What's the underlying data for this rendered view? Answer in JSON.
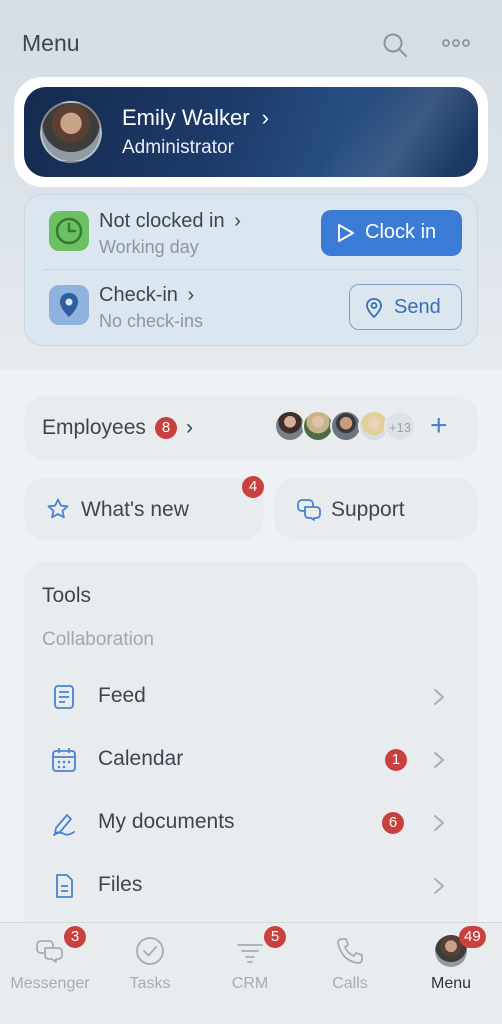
{
  "header": {
    "title": "Menu",
    "search_icon": "search-icon",
    "more_icon": "more-horizontal-icon"
  },
  "profile": {
    "name": "Emily Walker",
    "role": "Administrator",
    "chevron": "›"
  },
  "clock": {
    "status_title": "Not clocked in",
    "status_sub": "Working day",
    "clock_button": "Clock in",
    "checkin_title": "Check-in",
    "checkin_sub": "No check-ins",
    "send_button": "Send",
    "chevron": "›"
  },
  "employees": {
    "label": "Employees",
    "badge": "8",
    "more_count": "+13",
    "add": "+",
    "chevron": "›"
  },
  "whats_new": {
    "label": "What's new",
    "badge": "4"
  },
  "support": {
    "label": "Support"
  },
  "tools": {
    "title": "Tools",
    "section": "Collaboration",
    "items": [
      {
        "label": "Feed",
        "icon": "feed-icon",
        "badge": ""
      },
      {
        "label": "Calendar",
        "icon": "calendar-icon",
        "badge": "1"
      },
      {
        "label": "My documents",
        "icon": "signature-icon",
        "badge": "6"
      },
      {
        "label": "Files",
        "icon": "file-icon",
        "badge": ""
      }
    ]
  },
  "tabbar": {
    "tabs": [
      {
        "label": "Messenger",
        "badge": "3"
      },
      {
        "label": "Tasks",
        "badge": ""
      },
      {
        "label": "CRM",
        "badge": "5"
      },
      {
        "label": "Calls",
        "badge": ""
      },
      {
        "label": "Menu",
        "badge": "49"
      }
    ]
  },
  "colors": {
    "accent": "#3a7bd5",
    "badge": "#c9413f",
    "profile_bg": "#1d3b6b"
  }
}
